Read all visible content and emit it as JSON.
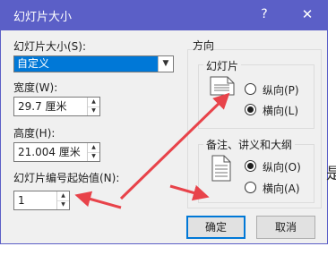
{
  "dialog": {
    "title": "幻灯片大小",
    "help_icon": "help-icon",
    "close_icon": "close-icon"
  },
  "slide_size": {
    "label": "幻灯片大小(S):",
    "selected": "自定义"
  },
  "width": {
    "label": "宽度(W):",
    "value": "29.7 厘米"
  },
  "height": {
    "label": "高度(H):",
    "value": "21.004 厘米"
  },
  "numbering": {
    "label": "幻灯片编号起始值(N):",
    "value": "1"
  },
  "orientation": {
    "group_label": "方向",
    "slides": {
      "group_label": "幻灯片",
      "portrait": "纵向(P)",
      "landscape": "横向(L)",
      "selected": "landscape"
    },
    "notes": {
      "group_label": "备注、讲义和大纲",
      "portrait": "纵向(O)",
      "landscape": "横向(A)",
      "selected": "portrait"
    }
  },
  "buttons": {
    "ok": "确定",
    "cancel": "取消"
  },
  "background": {
    "partial_char": "是"
  },
  "colors": {
    "titlebar": "#5b5fc7",
    "selection": "#0078d7",
    "arrow": "#e8434a"
  }
}
